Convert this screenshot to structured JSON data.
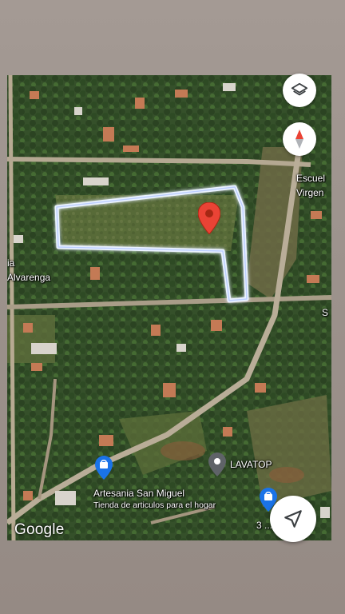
{
  "map": {
    "place_labels": {
      "escuela_line1": "Escuel",
      "escuela_line2": "Virgen",
      "alvarenga_line1": "ia",
      "alvarenga_line2": "Alvarenga",
      "edge_s": "S",
      "artesania_name": "Artesania San Miguel",
      "artesania_category": "Tienda de articulos para el hogar",
      "lavatop": "LAVATOP",
      "bottom_right_partial": "3 ... ve"
    },
    "logo": "Google"
  },
  "controls": {
    "layers_icon": "layers-icon",
    "compass_icon": "compass-icon",
    "navigate_icon": "navigation-arrow-icon"
  },
  "colors": {
    "pin_red": "#ea4335",
    "poi_blue": "#1a73e8",
    "poi_gray": "#5f6368",
    "boundary_glow": "#e8f0ff",
    "vegetation": "#3e5a2c"
  }
}
